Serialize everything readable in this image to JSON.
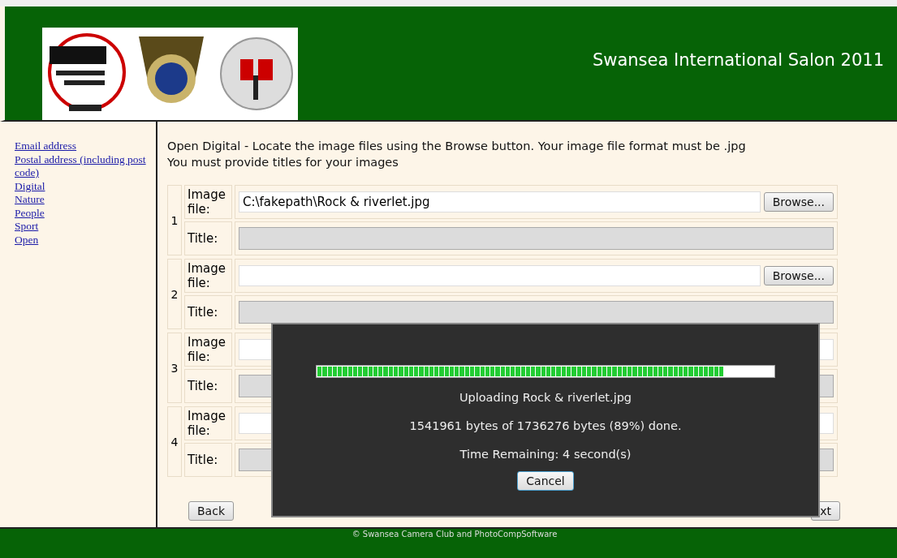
{
  "header": {
    "title": "Swansea International Salon 2011"
  },
  "sidebar": {
    "links": [
      {
        "label": "Email address"
      },
      {
        "label": "Postal address (including post code)"
      },
      {
        "label": "Digital"
      },
      {
        "label": "Nature"
      },
      {
        "label": "People"
      },
      {
        "label": "Sport"
      },
      {
        "label": "Open"
      }
    ]
  },
  "instructions": [
    "Open Digital - Locate the image files using the Browse button. Your image file format must be .jpg",
    "You must provide titles for your images"
  ],
  "entries": [
    {
      "number": "1",
      "file_label": "Image file:",
      "file_value": "C:\\fakepath\\Rock & riverlet.jpg",
      "browse": "Browse...",
      "title_label": "Title:",
      "title_disabled": true
    },
    {
      "number": "2",
      "file_label": "Image file:",
      "browse": "Browse...",
      "title_label": "Title:",
      "title_disabled": true
    },
    {
      "number": "3",
      "file_label": "Image file:",
      "title_label": "Title:",
      "title_disabled": true
    },
    {
      "number": "4",
      "file_label": "Image file:",
      "title_label": "Title:",
      "title_disabled": true
    }
  ],
  "buttons": {
    "back": "Back",
    "next": "xt"
  },
  "upload_dialog": {
    "level": 0.89,
    "filename_line": "Uploading Rock & riverlet.jpg",
    "bytes_line": "1541961 bytes of 1736276 bytes (89%) done.",
    "time_line": "Time Remaining: 4 second(s)",
    "cancel": "Cancel"
  },
  "footer": {
    "text": "© Swansea Camera Club  and PhotoCompSoftware"
  }
}
